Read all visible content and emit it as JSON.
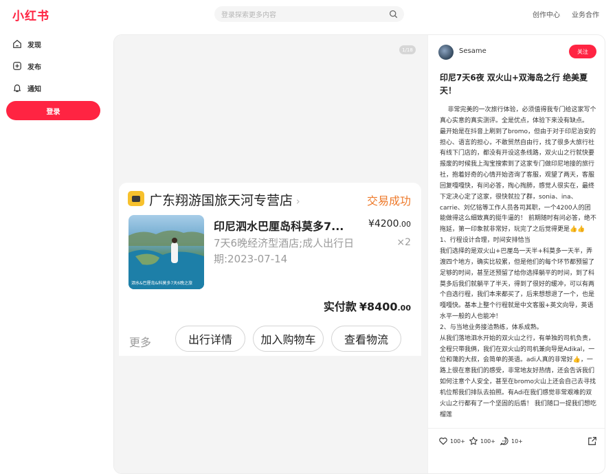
{
  "header": {
    "logo": "小红书",
    "search_placeholder": "登录探索更多内容",
    "links": [
      "创作中心",
      "业务合作"
    ]
  },
  "sidebar": {
    "items": [
      {
        "label": "发现",
        "icon": "home-icon"
      },
      {
        "label": "发布",
        "icon": "plus-square-icon"
      },
      {
        "label": "通知",
        "icon": "bell-icon"
      }
    ],
    "login_label": "登录"
  },
  "media": {
    "page_indicator": "1/18",
    "order": {
      "shop_name": "广东翔游国旅天河专营店",
      "status": "交易成功",
      "thumb_caption": "泗水&巴厘岛&科莫多7天6晚之旅",
      "title": "印尼泗水巴厘岛科莫多7...",
      "price_main": "¥4200",
      "price_decimal": ".00",
      "subtitle": "7天6晚经济型酒店;成人出行日期:2023-07-14",
      "quantity": "×2",
      "total_label": "实付款",
      "total_main": "¥8400",
      "total_decimal": ".00",
      "more": "更多",
      "buttons": [
        "出行详情",
        "加入购物车",
        "查看物流"
      ]
    }
  },
  "note": {
    "author": "Sesame",
    "follow_label": "关注",
    "title": "印尼7天6夜 双火山+双海岛之行 绝美夏天！",
    "body": "    非常完美的一次旅行体验，必须值得我专门给这家写个真心实意的真实测评。全是优点，体验下来没有缺点。\n最开始是在抖音上刷到了bromo，但由于对于印尼治安的担心、语言的担心，不敢贸然自由行，找了很多大旅行社有线下门店的，都没有开设这条线路，双火山之行就快要报废的时候我上淘宝搜索到了这家专门做印尼地接的旅行社，抱着好奇的心情开始咨询了客服，观望了两天，客服回复嘎嘎快，有问必答，掏心掏肺，感觉人很实在，最终下定决心定了这家，很快就拉了群，sonia、ina、carrie、刘亿铭等工作人员各司其职，一个4200人的团能做得这么细致真的挺牛逼的！ 前期随时有问必答，绝不拖延，第一印象就非常好，玩完了之后觉得更是👍👍\n1、行程设计合理，时间安排恰当\n我们选择的是双火山+巴厘岛一天半+科莫多一天半，弄渡四个地方，确实比较累，但是他们的每个环节都预留了足够的时间，甚至还预留了给你选择躺平的时间，到了科莫多后我们就躺平了半天，得到了很好的缓冲，可以有两个自选行程，我们本来都买了，后来想想退了一个，也是嘎嘎快。基本上整个行程就是中文客服+英文向导，英语水平一般的人也能冲！\n2、与当地业务接洽熟练，体系成熟。\n从我们落地泗水开始的双火山之行，有单独的司机负责，全程只带我俩，我们在双火山的司机兼向导是Adikal，一位和蔼的大叔，会简单的英语。adi人真的非常好👍，一路上很在意我们的感受，非常地友好热情，还会告诉我们如何注意个人安全，甚至在bromo火山上还会自己去寻找机位帮我们排队去拍照。有Adi在我们感觉非常艰难的双火山之行都有了一个坚固的后盾！ 我们随口一提我们想吃榴莲",
    "likes": "100+",
    "collects": "100+",
    "comments": "10+"
  }
}
